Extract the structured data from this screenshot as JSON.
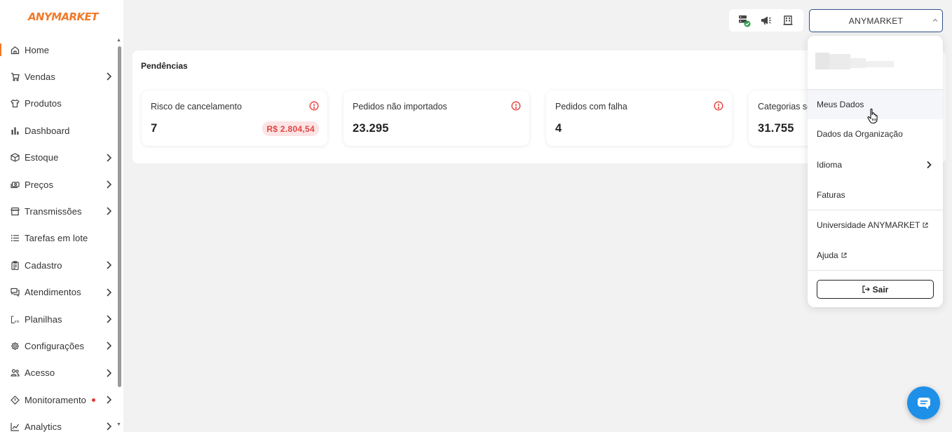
{
  "brand": {
    "logo_text": "ANYMARKET",
    "accent": "#f07a2a"
  },
  "sidebar": {
    "items": [
      {
        "label": "Home",
        "icon": "home-icon",
        "has_children": false,
        "active": true
      },
      {
        "label": "Vendas",
        "icon": "cart-icon",
        "has_children": true
      },
      {
        "label": "Produtos",
        "icon": "shirt-icon",
        "has_children": false
      },
      {
        "label": "Dashboard",
        "icon": "bar-chart-icon",
        "has_children": false
      },
      {
        "label": "Estoque",
        "icon": "box-icon",
        "has_children": true
      },
      {
        "label": "Preços",
        "icon": "money-icon",
        "has_children": true
      },
      {
        "label": "Transmissões",
        "icon": "store-icon",
        "has_children": true
      },
      {
        "label": "Tarefas em lote",
        "icon": "list-icon",
        "has_children": false
      },
      {
        "label": "Cadastro",
        "icon": "clipboard-icon",
        "has_children": true
      },
      {
        "label": "Atendimentos",
        "icon": "chat-icon",
        "has_children": true
      },
      {
        "label": "Planilhas",
        "icon": "spreadsheet-icon",
        "has_children": true
      },
      {
        "label": "Configurações",
        "icon": "gear-icon",
        "has_children": true
      },
      {
        "label": "Acesso",
        "icon": "users-icon",
        "has_children": true
      },
      {
        "label": "Monitoramento",
        "icon": "diamond-icon",
        "has_children": true,
        "alert_dot": true
      },
      {
        "label": "Analytics",
        "icon": "line-chart-icon",
        "has_children": true
      }
    ]
  },
  "topbar": {
    "icons": [
      "server-status-icon",
      "megaphone-icon",
      "building-icon"
    ],
    "org_select": {
      "value": "ANYMARKET"
    }
  },
  "pendencias": {
    "title": "Pendências",
    "cards": [
      {
        "title": "Risco de cancelamento",
        "value": "7",
        "badge": "R$ 2.804,54"
      },
      {
        "title": "Pedidos não importados",
        "value": "23.295"
      },
      {
        "title": "Pedidos com falha",
        "value": "4"
      },
      {
        "title": "Categorias sem",
        "value": "31.755"
      }
    ]
  },
  "user_menu": {
    "items": {
      "meus_dados": "Meus Dados",
      "dados_org": "Dados da Organização",
      "idioma": "Idioma",
      "faturas": "Faturas",
      "universidade": "Universidade ANYMARKET",
      "ajuda": "Ajuda"
    },
    "logout_label": "Sair"
  },
  "colors": {
    "primary_border": "#2f4f88",
    "alert_red": "#e53935",
    "chat_blue": "#1e90e8",
    "status_green": "#2e9e4f"
  }
}
